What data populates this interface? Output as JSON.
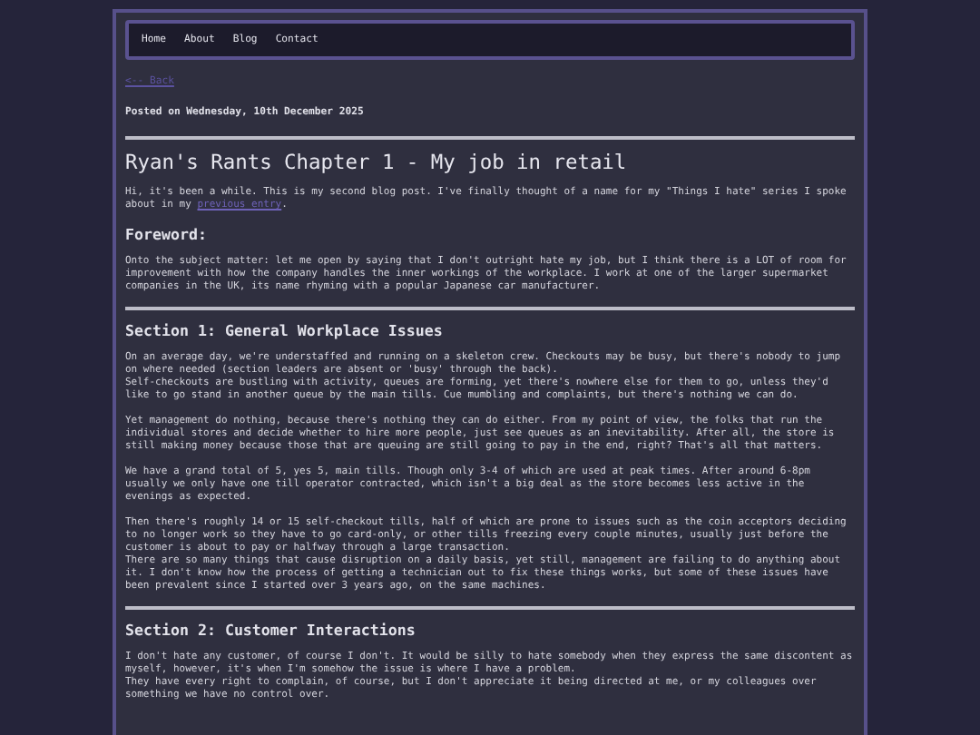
{
  "nav": [
    {
      "label": "Home"
    },
    {
      "label": "About"
    },
    {
      "label": "Blog"
    },
    {
      "label": "Contact"
    }
  ],
  "back_link": "<-- Back",
  "posted": "Posted on Wednesday, 10th December 2025",
  "blocks": [
    {
      "kind": "rule"
    },
    {
      "kind": "title",
      "text": "Ryan's Rants Chapter 1 - My job in retail"
    },
    {
      "kind": "paragraph",
      "parts": [
        {
          "text": "Hi, it's been a while. This is my second blog post. I've finally thought of a name for my \"Things I hate\" series I spoke about in my ",
          "kind": "text"
        },
        {
          "text": "previous entry",
          "kind": "link"
        },
        {
          "text": ".",
          "kind": "text"
        }
      ]
    },
    {
      "kind": "heading",
      "text": "Foreword:"
    },
    {
      "kind": "paragraph",
      "text": "Onto the subject matter: let me open by saying that I don't outright hate my job, but I think there is a LOT of room for improvement with how the company handles the inner workings of the workplace. I work at one of the larger supermarket companies in the UK, its name rhyming with a popular Japanese car manufacturer."
    },
    {
      "kind": "rule"
    },
    {
      "kind": "heading",
      "text": "Section 1: General Workplace Issues"
    },
    {
      "kind": "paragraph",
      "text": "On an average day, we're understaffed and running on a skeleton crew. Checkouts may be busy, but there's nobody to jump on where needed (section leaders are absent or 'busy' through the back).\nSelf-checkouts are bustling with activity, queues are forming, yet there's nowhere else for them to go, unless they'd like to go stand in another queue by the main tills. Cue mumbling and complaints, but there's nothing we can do."
    },
    {
      "kind": "paragraph",
      "text": "Yet management do nothing, because there's nothing they can do either. From my point of view, the folks that run the individual stores and decide whether to hire more people, just see queues as an inevitability. After all, the store is still making money because those that are queuing are still going to pay in the end, right? That's all that matters."
    },
    {
      "kind": "paragraph",
      "text": "We have a grand total of 5, yes 5, main tills. Though only 3-4 of which are used at peak times. After around 6-8pm usually we only have one till operator contracted, which isn't a big deal as the store becomes less active in the evenings as expected."
    },
    {
      "kind": "paragraph",
      "text": "Then there's roughly 14 or 15 self-checkout tills, half of which are prone to issues such as the coin acceptors deciding to no longer work so they have to go card-only, or other tills freezing every couple minutes, usually just before the customer is about to pay or halfway through a large transaction.\nThere are so many things that cause disruption on a daily basis, yet still, management are failing to do anything about it. I don't know how the process of getting a technician out to fix these things works, but some of these issues have been prevalent since I started over 3 years ago, on the same machines."
    },
    {
      "kind": "rule"
    },
    {
      "kind": "heading",
      "text": "Section 2: Customer Interactions"
    },
    {
      "kind": "paragraph",
      "text": "I don't hate any customer, of course I don't. It would be silly to hate somebody when they express the same discontent as myself, however, it's when I'm somehow the issue is where I have a problem.\nThey have every right to complain, of course, but I don't appreciate it being directed at me, or my colleagues over something we have no control over."
    }
  ]
}
